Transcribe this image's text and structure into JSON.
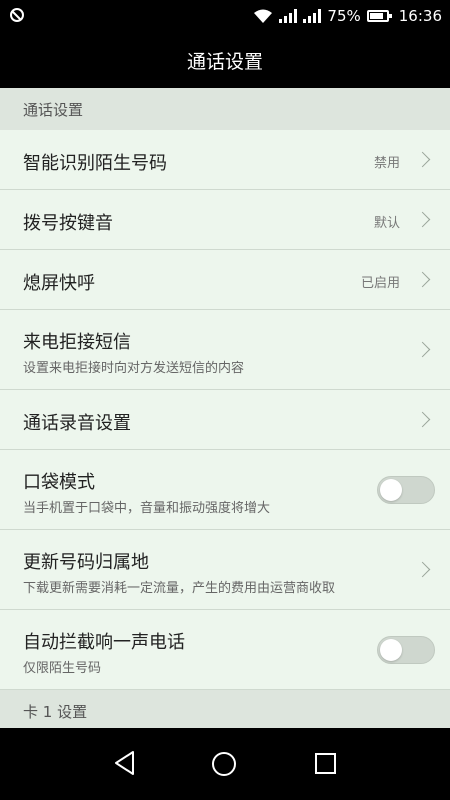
{
  "status_bar": {
    "battery": "75%",
    "time": "16:36"
  },
  "title": "通话设置",
  "sections": [
    {
      "header": "通话设置",
      "rows": [
        {
          "title": "智能识别陌生号码",
          "value": "禁用"
        },
        {
          "title": "拨号按键音",
          "value": "默认"
        },
        {
          "title": "熄屏快呼",
          "value": "已启用"
        },
        {
          "title": "来电拒接短信",
          "subtitle": "设置来电拒接时向对方发送短信的内容"
        },
        {
          "title": "通话录音设置"
        },
        {
          "title": "口袋模式",
          "subtitle": "当手机置于口袋中，音量和振动强度将增大",
          "toggle": false
        },
        {
          "title": "更新号码归属地",
          "subtitle": "下载更新需要消耗一定流量，产生的费用由运营商收取"
        },
        {
          "title": "自动拦截响一声电话",
          "subtitle": "仅限陌生号码",
          "toggle": false
        }
      ]
    },
    {
      "header": "卡 1 设置"
    }
  ],
  "icons": {
    "status_left": "no-disturb-icon",
    "wifi": "wifi-icon",
    "signal": "signal-icon",
    "battery": "battery-icon",
    "chevron": "chevron-right-icon",
    "nav_back": "back-icon",
    "nav_home": "home-icon",
    "nav_recent": "recent-apps-icon"
  }
}
